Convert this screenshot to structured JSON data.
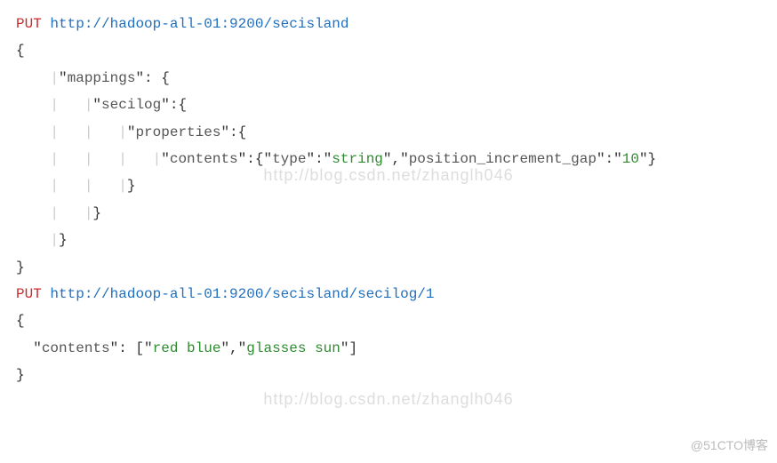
{
  "req1": {
    "method": "PUT",
    "url": "http://hadoop-all-01:9200/secisland",
    "body": {
      "open": "{",
      "l2_a": "    \"",
      "l2_key": "mappings",
      "l2_b": "\": {",
      "l3_a": "        \"",
      "l3_key": "secilog",
      "l3_b": "\":{",
      "l4_a": "            \"",
      "l4_key": "properties",
      "l4_b": "\":{",
      "l5_a": "                \"",
      "l5_key": "contents",
      "l5_b": "\":{\"",
      "l5_key2": "type",
      "l5_c": "\":\"",
      "l5_val1": "string",
      "l5_d": "\",\"",
      "l5_key3": "position_increment_gap",
      "l5_e": "\":\"",
      "l5_val2": "10",
      "l5_f": "\"}",
      "l6": "            }",
      "l7": "        }",
      "l8": "    }",
      "close": "}"
    }
  },
  "req2": {
    "method": "PUT",
    "url": "http://hadoop-all-01:9200/secisland/secilog/1",
    "body": {
      "open": "{",
      "l2_a": "  \"",
      "l2_key": "contents",
      "l2_b": "\": [\"",
      "l2_v1": "red blue",
      "l2_c": "\",\"",
      "l2_v2": "glasses sun",
      "l2_d": "\"]",
      "close": "}"
    }
  },
  "watermarks": {
    "center1": "http://blog.csdn.net/zhanglh046",
    "center2": "http://blog.csdn.net/zhanglh046",
    "corner": "@51CTO博客"
  },
  "guides": {
    "g4": "    |",
    "g8": "    |   |",
    "g12": "    |   |   |",
    "g16": "    |   |   |   |"
  }
}
